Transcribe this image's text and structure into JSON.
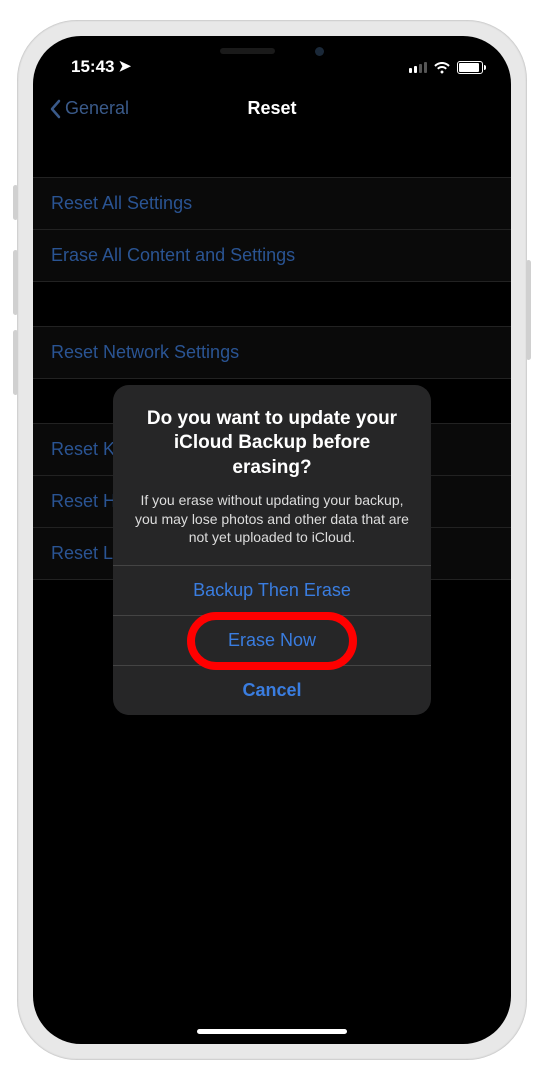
{
  "status": {
    "time": "15:43"
  },
  "nav": {
    "back_label": "General",
    "title": "Reset"
  },
  "list": {
    "group1": [
      {
        "label": "Reset All Settings"
      },
      {
        "label": "Erase All Content and Settings"
      }
    ],
    "group2": [
      {
        "label": "Reset Network Settings"
      }
    ],
    "group3": [
      {
        "label": "Reset Keyboard Dictionary"
      },
      {
        "label": "Reset Home Screen Layout"
      },
      {
        "label": "Reset Location & Privacy"
      }
    ]
  },
  "alert": {
    "title": "Do you want to update your iCloud Backup before erasing?",
    "message": "If you erase without updating your backup, you may lose photos and other data that are not yet uploaded to iCloud.",
    "backup_label": "Backup Then Erase",
    "erase_label": "Erase Now",
    "cancel_label": "Cancel"
  },
  "highlight": {
    "target": "erase-now-button",
    "color": "#ff0000"
  }
}
